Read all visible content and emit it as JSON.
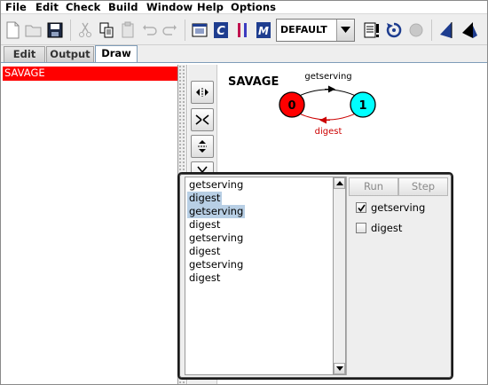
{
  "menu": [
    "File",
    "Edit",
    "Check",
    "Build",
    "Window",
    "Help",
    "Options"
  ],
  "toolbar": {
    "target_selector": {
      "selected": "DEFAULT"
    }
  },
  "tabs": [
    {
      "label": "Edit",
      "active": false
    },
    {
      "label": "Output",
      "active": false
    },
    {
      "label": "Draw",
      "active": true
    }
  ],
  "process_list": [
    {
      "name": "SAVAGE",
      "selected": true
    }
  ],
  "diagram": {
    "title": "SAVAGE",
    "states": [
      {
        "label": "0",
        "color": "#ff0000"
      },
      {
        "label": "1",
        "color": "#00ffff"
      }
    ],
    "transitions": [
      {
        "label": "getserving",
        "color": "#000000"
      },
      {
        "label": "digest",
        "color": "#cc0000"
      }
    ]
  },
  "animator": {
    "trace": [
      {
        "text": "getserving",
        "highlight": false
      },
      {
        "text": "digest",
        "highlight": true
      },
      {
        "text": "getserving",
        "highlight": true
      },
      {
        "text": "digest",
        "highlight": false
      },
      {
        "text": "getserving",
        "highlight": false
      },
      {
        "text": "digest",
        "highlight": false
      },
      {
        "text": "getserving",
        "highlight": false
      },
      {
        "text": "digest",
        "highlight": false
      }
    ],
    "buttons": {
      "run": "Run",
      "step": "Step"
    },
    "actions": [
      {
        "label": "getserving",
        "checked": true
      },
      {
        "label": "digest",
        "checked": false
      }
    ]
  }
}
